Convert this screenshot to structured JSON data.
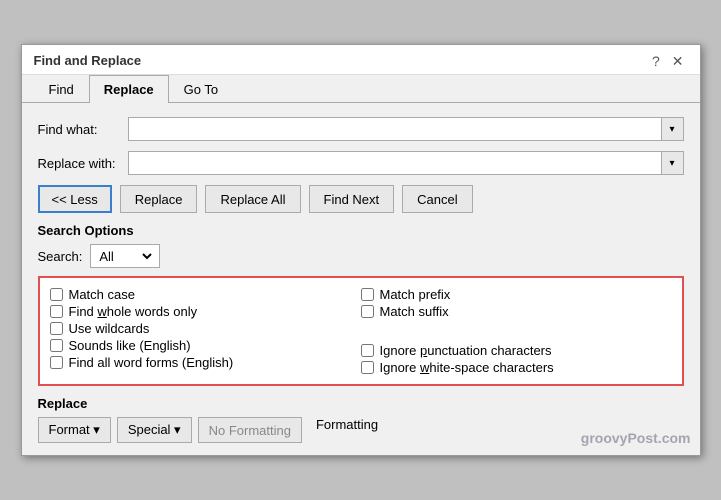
{
  "dialog": {
    "title": "Find and Replace",
    "help_icon": "?",
    "close_icon": "✕"
  },
  "tabs": [
    {
      "label": "Find",
      "active": false
    },
    {
      "label": "Replace",
      "active": true
    },
    {
      "label": "Go To",
      "active": false
    }
  ],
  "find_what": {
    "label": "Find what:",
    "value": "",
    "placeholder": ""
  },
  "replace_with": {
    "label": "Replace with:",
    "value": "",
    "placeholder": ""
  },
  "buttons": {
    "less": "<< Less",
    "replace": "Replace",
    "replace_all": "Replace All",
    "find_next": "Find Next",
    "cancel": "Cancel"
  },
  "search_options": {
    "label": "Search Options",
    "search_label": "Search:",
    "search_value": "All"
  },
  "checkboxes": {
    "left": [
      {
        "id": "match-case",
        "label": "Match case",
        "checked": false,
        "underline_char": null
      },
      {
        "id": "whole-words",
        "label": "Find whole words only",
        "checked": false,
        "underline_char": "w"
      },
      {
        "id": "wildcards",
        "label": "Use wildcards",
        "checked": false,
        "underline_char": null
      },
      {
        "id": "sounds-like",
        "label": "Sounds like (English)",
        "checked": false,
        "underline_char": null
      },
      {
        "id": "word-forms",
        "label": "Find all word forms (English)",
        "checked": false,
        "underline_char": null
      }
    ],
    "right": [
      {
        "id": "match-prefix",
        "label": "Match prefix",
        "checked": false,
        "underline_char": null
      },
      {
        "id": "match-suffix",
        "label": "Match suffix",
        "checked": false,
        "underline_char": null
      },
      {
        "id": "ignore-punct",
        "label": "Ignore punctuation characters",
        "checked": false,
        "underline_char": "p"
      },
      {
        "id": "ignore-space",
        "label": "Ignore white-space characters",
        "checked": false,
        "underline_char": "w"
      }
    ]
  },
  "replace_section": {
    "label": "Replace",
    "format_btn": "Format ▾",
    "special_btn": "Special ▾",
    "no_format_btn": "No Formatting",
    "formatting_label": "Formatting"
  },
  "watermark": "groovyPost.com"
}
